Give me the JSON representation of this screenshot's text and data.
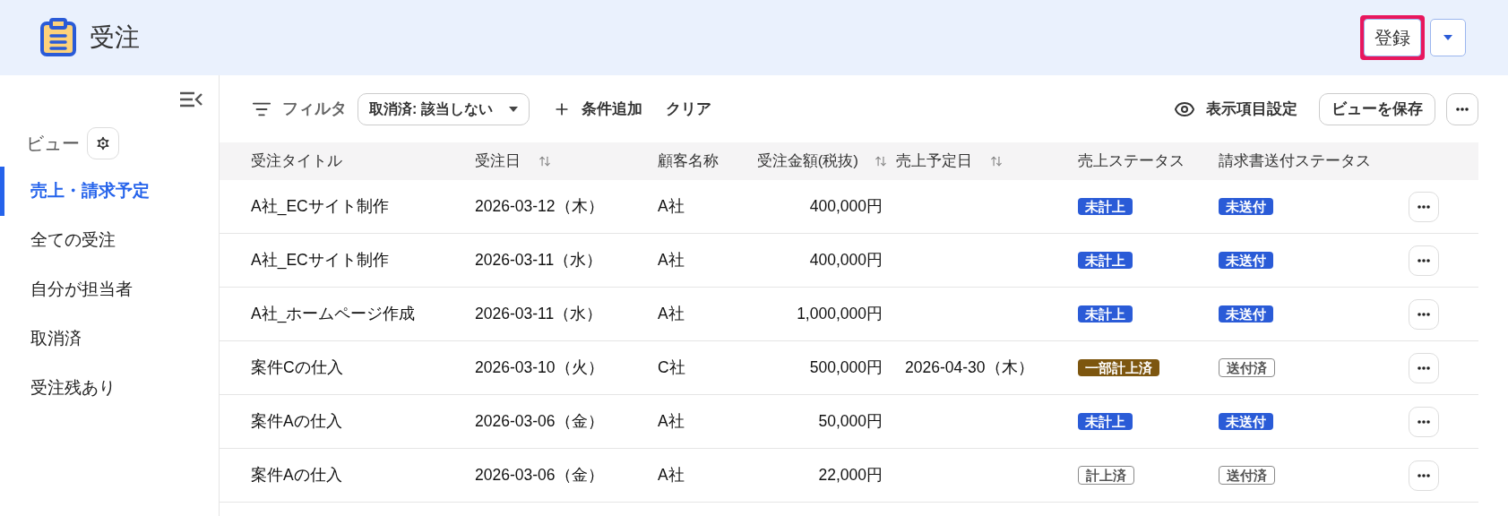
{
  "header": {
    "title": "受注",
    "register_button": {
      "label": "登録",
      "highlighted": true
    }
  },
  "sidebar": {
    "heading": "ビュー",
    "items": [
      {
        "label": "売上・請求予定",
        "selected": true
      },
      {
        "label": "全ての受注",
        "selected": false
      },
      {
        "label": "自分が担当者",
        "selected": false
      },
      {
        "label": "取消済",
        "selected": false
      },
      {
        "label": "受注残あり",
        "selected": false
      }
    ]
  },
  "toolbar": {
    "filter_label": "フィルタ",
    "filter_chip": "取消済: 該当しない",
    "add_condition": "条件追加",
    "clear": "クリア",
    "column_settings": "表示項目設定",
    "save_view": "ビューを保存"
  },
  "table": {
    "columns": [
      {
        "label": "受注タイトル",
        "sortable": false
      },
      {
        "label": "受注日",
        "sortable": true
      },
      {
        "label": "顧客名称",
        "sortable": false
      },
      {
        "label": "受注金額(税抜)",
        "sortable": true
      },
      {
        "label": "売上予定日",
        "sortable": true
      },
      {
        "label": "売上ステータス",
        "sortable": false
      },
      {
        "label": "請求書送付ステータス",
        "sortable": false
      }
    ],
    "rows": [
      {
        "title": "A社_ECサイト制作",
        "date": "2026-03-12（木）",
        "customer": "A社",
        "amount": "400,000円",
        "sales_date": "",
        "sales_status": {
          "label": "未計上",
          "kind": "filled",
          "color": "#2a5bd7"
        },
        "invoice_status": {
          "label": "未送付",
          "kind": "filled",
          "color": "#2a5bd7"
        }
      },
      {
        "title": "A社_ECサイト制作",
        "date": "2026-03-11（水）",
        "customer": "A社",
        "amount": "400,000円",
        "sales_date": "",
        "sales_status": {
          "label": "未計上",
          "kind": "filled",
          "color": "#2a5bd7"
        },
        "invoice_status": {
          "label": "未送付",
          "kind": "filled",
          "color": "#2a5bd7"
        }
      },
      {
        "title": "A社_ホームページ作成",
        "date": "2026-03-11（水）",
        "customer": "A社",
        "amount": "1,000,000円",
        "sales_date": "",
        "sales_status": {
          "label": "未計上",
          "kind": "filled",
          "color": "#2a5bd7"
        },
        "invoice_status": {
          "label": "未送付",
          "kind": "filled",
          "color": "#2a5bd7"
        }
      },
      {
        "title": "案件Cの仕入",
        "date": "2026-03-10（火）",
        "customer": "C社",
        "amount": "500,000円",
        "sales_date": "2026-04-30（木）",
        "sales_status": {
          "label": "一部計上済",
          "kind": "filled",
          "color": "#7d560f"
        },
        "invoice_status": {
          "label": "送付済",
          "kind": "outline",
          "color": "#8a8a8a"
        }
      },
      {
        "title": "案件Aの仕入",
        "date": "2026-03-06（金）",
        "customer": "A社",
        "amount": "50,000円",
        "sales_date": "",
        "sales_status": {
          "label": "未計上",
          "kind": "filled",
          "color": "#2a5bd7"
        },
        "invoice_status": {
          "label": "未送付",
          "kind": "filled",
          "color": "#2a5bd7"
        }
      },
      {
        "title": "案件Aの仕入",
        "date": "2026-03-06（金）",
        "customer": "A社",
        "amount": "22,000円",
        "sales_date": "",
        "sales_status": {
          "label": "計上済",
          "kind": "outline",
          "color": "#8a8a8a"
        },
        "invoice_status": {
          "label": "送付済",
          "kind": "outline",
          "color": "#8a8a8a"
        }
      }
    ]
  }
}
